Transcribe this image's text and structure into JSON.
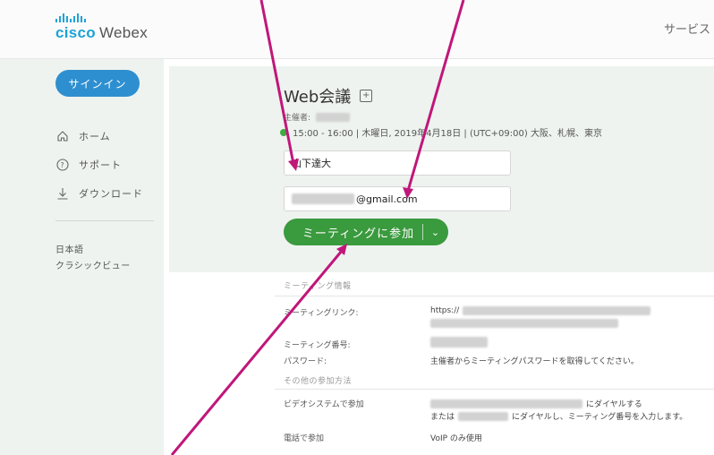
{
  "header": {
    "logo_text_brand": "cisco",
    "logo_text_product": "Webex",
    "services": "サービス"
  },
  "sidebar": {
    "signin": "サインイン",
    "items": [
      {
        "label": "ホーム",
        "icon": "home-icon"
      },
      {
        "label": "サポート",
        "icon": "help-circle-icon"
      },
      {
        "label": "ダウンロード",
        "icon": "download-icon"
      }
    ],
    "language": "日本語",
    "classic_view": "クラシックビュー"
  },
  "meeting": {
    "title": "Web会議",
    "host_label": "主催者:",
    "time": "15:00 - 16:00 | 木曜日, 2019年4月18日 | (UTC+09:00) 大阪、札幌、東京",
    "name_value": "山下達大",
    "email_value": "@gmail.com",
    "join_button": "ミーティングに参加"
  },
  "info": {
    "section_title": "ミーティング情報",
    "link_label": "ミーティングリンク:",
    "link_value": "https://",
    "number_label": "ミーティング番号:",
    "password_label": "パスワード:",
    "password_value": "主催者からミーティングパスワードを取得してください。",
    "other_title": "その他の参加方法",
    "video_label": "ビデオシステムで参加",
    "video_value_1": "にダイヤルする",
    "video_or": "または",
    "video_value_2": "にダイヤルし、ミーティング番号を入力します。",
    "phone_label": "電話で参加",
    "phone_value": "VoIP のみ使用"
  },
  "colors": {
    "brand": "#1ea2d6",
    "signin": "#2e8fd0",
    "join": "#3a9a3e",
    "arrow": "#c0177a"
  }
}
